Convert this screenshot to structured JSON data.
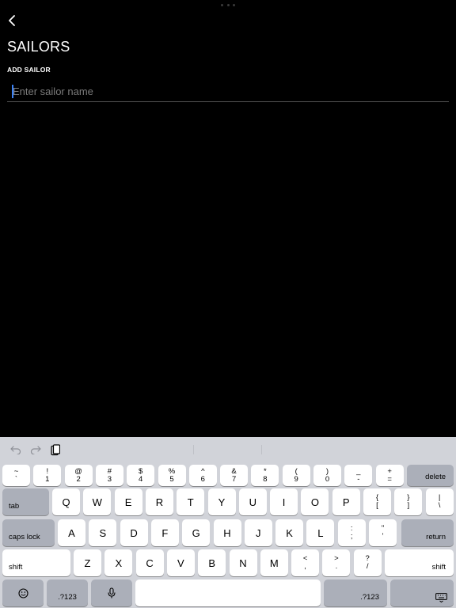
{
  "screen": {
    "title": "SAILORS",
    "section_label": "ADD SAILOR",
    "name_input": {
      "placeholder": "Enter sailor name",
      "value": ""
    }
  },
  "keyboard": {
    "number_row": [
      {
        "top": "~",
        "bottom": "`"
      },
      {
        "top": "!",
        "bottom": "1"
      },
      {
        "top": "@",
        "bottom": "2"
      },
      {
        "top": "#",
        "bottom": "3"
      },
      {
        "top": "$",
        "bottom": "4"
      },
      {
        "top": "%",
        "bottom": "5"
      },
      {
        "top": "^",
        "bottom": "6"
      },
      {
        "top": "&",
        "bottom": "7"
      },
      {
        "top": "*",
        "bottom": "8"
      },
      {
        "top": "(",
        "bottom": "9"
      },
      {
        "top": ")",
        "bottom": "0"
      },
      {
        "top": "_",
        "bottom": "-"
      },
      {
        "top": "+",
        "bottom": "="
      }
    ],
    "delete_label": "delete",
    "tab_label": "tab",
    "row_q": [
      "Q",
      "W",
      "E",
      "R",
      "T",
      "Y",
      "U",
      "I",
      "O",
      "P"
    ],
    "row_q_symbols": [
      {
        "top": "{",
        "bottom": "["
      },
      {
        "top": "}",
        "bottom": "]"
      },
      {
        "top": "|",
        "bottom": "\\"
      }
    ],
    "caps_label": "caps lock",
    "row_a": [
      "A",
      "S",
      "D",
      "F",
      "G",
      "H",
      "J",
      "K",
      "L"
    ],
    "row_a_symbols": [
      {
        "top": ":",
        "bottom": ";"
      },
      {
        "top": "\"",
        "bottom": "'"
      }
    ],
    "return_label": "return",
    "shift_left_label": "shift",
    "row_z": [
      "Z",
      "X",
      "C",
      "V",
      "B",
      "N",
      "M"
    ],
    "row_z_symbols": [
      {
        "top": "<",
        "bottom": ","
      },
      {
        "top": ">",
        "bottom": "."
      },
      {
        "top": "?",
        "bottom": "/"
      }
    ],
    "shift_right_label": "shift",
    "numbers_left_label": ".?123",
    "numbers_right_label": ".?123",
    "colors": {
      "background": "#d1d3d9",
      "key": "#ffffff",
      "dark_key": "#abafb9"
    }
  }
}
